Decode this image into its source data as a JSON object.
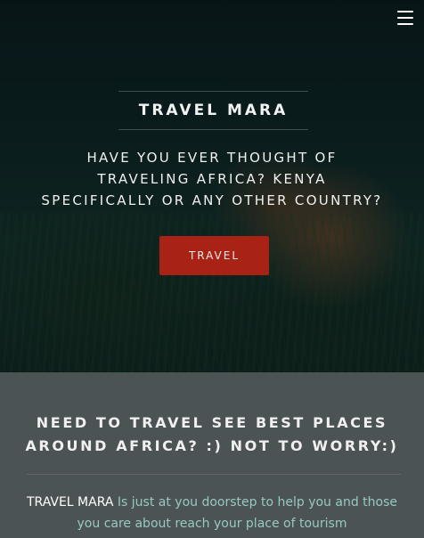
{
  "header": {
    "menu_icon": "hamburger-menu-icon"
  },
  "hero": {
    "brand": "TRAVEL MARA",
    "tagline_lines": [
      "HAVE YOU EVER THOUGHT OF",
      "TRAVELING AFRICA? KENYA",
      "SPECIFICALLY OR ANY OTHER COUNTRY?"
    ],
    "cta_label": "TRAVEL",
    "cta_color": "#a82316"
  },
  "info": {
    "heading_lines": [
      "NEED TO TRAVEL SEE BEST PLACES",
      "AROUND AFRICA? :) NOT TO WORRY:)"
    ],
    "body_brand": "TRAVEL MARA",
    "body_text": " Is just at you doorstep to help you and those you care about reach your place of tourism",
    "background_color": "#4c5355",
    "text_color": "#98c9c1"
  }
}
